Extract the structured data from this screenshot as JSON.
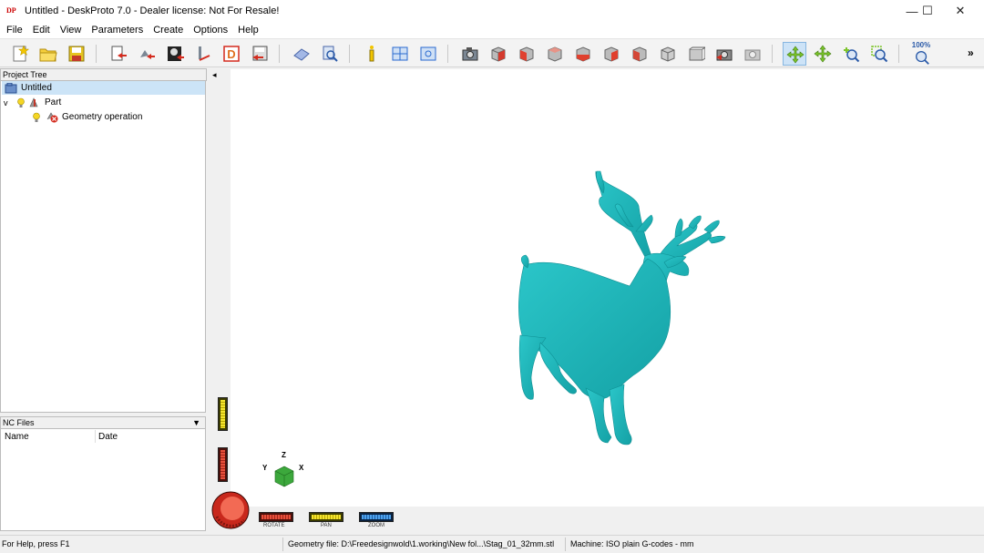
{
  "window": {
    "title": "Untitled - DeskProto 7.0 - Dealer license: Not For Resale!",
    "app_icon_text": "DP",
    "controls": {
      "minimize": "—",
      "maximize": "☐",
      "close": "✕"
    }
  },
  "menu": {
    "items": [
      "File",
      "Edit",
      "View",
      "Parameters",
      "Create",
      "Options",
      "Help"
    ]
  },
  "toolbar": {
    "zoom_level": "100%",
    "overflow": "»"
  },
  "project_tree": {
    "header": "Project Tree",
    "items": [
      {
        "label": "Untitled",
        "selected": true
      },
      {
        "label": "Part",
        "expander": "v"
      },
      {
        "label": "Geometry operation"
      }
    ]
  },
  "nc_files": {
    "header": "NC Files",
    "columns": [
      "Name",
      "Date"
    ],
    "collapse_glyph": "▼"
  },
  "viewport": {
    "panel_toggle": "◂",
    "axes": {
      "x": "X",
      "y": "Y",
      "z": "Z"
    },
    "controls": {
      "rotate": "ROTATE",
      "pan": "PAN",
      "zoom": "ZOOM"
    },
    "model_color": "#1fb5b8"
  },
  "status": {
    "help": "For Help, press F1",
    "geometry_file": "Geometry file: D:\\Freedesignwold\\1.working\\New fol...\\Stag_01_32mm.stl",
    "machine": "Machine: ISO plain G-codes - mm"
  }
}
